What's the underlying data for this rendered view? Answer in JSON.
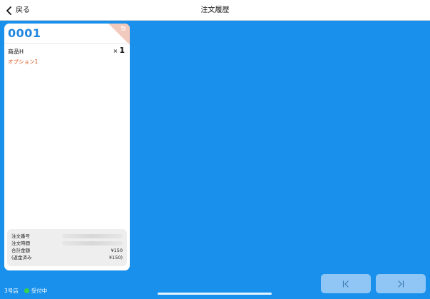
{
  "header": {
    "back_label": "戻る",
    "title": "注文履歴"
  },
  "order": {
    "number": "0001",
    "items": [
      {
        "name": "商品H",
        "qty_prefix": "×",
        "qty": "1",
        "option": "オプション1"
      }
    ],
    "summary": {
      "order_no_label": "注文番号",
      "order_time_label": "注文時間",
      "total_label": "合計金額",
      "total_value": "¥150",
      "refunded_label": "(返金済み",
      "refunded_value": "¥150)"
    }
  },
  "footer": {
    "store_name": "3号店",
    "status_label": "受付中"
  },
  "colors": {
    "background": "#1890ec",
    "order_number": "#1f86e0",
    "option_text": "#d9541e",
    "status_dot": "#39d34a",
    "nav_button": "#8fc6f5"
  },
  "icons": {
    "back": "chevron-left-icon",
    "corner": "refund-corner-icon",
    "first": "skip-first-icon",
    "last": "skip-last-icon"
  }
}
